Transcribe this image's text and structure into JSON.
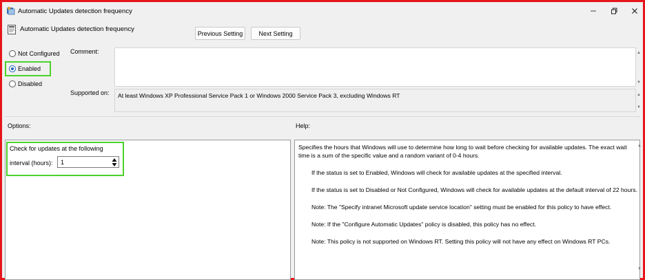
{
  "window": {
    "title": "Automatic Updates detection frequency",
    "controls": [
      "minimize-icon",
      "restore-icon",
      "close-icon"
    ]
  },
  "header": {
    "title": "Automatic Updates detection frequency",
    "previous_label": "Previous Setting",
    "next_label": "Next Setting"
  },
  "state": {
    "options": [
      "Not Configured",
      "Enabled",
      "Disabled"
    ],
    "selected": "Enabled"
  },
  "comment": {
    "label": "Comment:",
    "value": ""
  },
  "supported": {
    "label": "Supported on:",
    "value": "At least Windows XP Professional Service Pack 1 or Windows 2000 Service Pack 3, excluding Windows RT"
  },
  "options_panel": {
    "heading": "Options:",
    "line1": "Check for updates at the following",
    "interval_label": "interval (hours):",
    "interval_value": "1"
  },
  "help_panel": {
    "heading": "Help:",
    "paragraphs": [
      "Specifies the hours that Windows will use to determine how long to wait before checking for available updates. The exact wait time is a sum of the specific value and a random variant of 0-4 hours.",
      "If the status is set to Enabled, Windows will check for available updates at the specified interval.",
      "If the status is set to Disabled or Not Configured, Windows will check for available updates at the default interval of 22 hours.",
      "Note: The \"Specify intranet Microsoft update service location\" setting must be enabled for this policy to have effect.",
      "Note: If the \"Configure Automatic Updates\" policy is disabled, this policy has no effect.",
      "Note: This policy is not supported on Windows RT. Setting this policy will not have any effect on Windows RT PCs."
    ]
  },
  "colors": {
    "highlight": "#4cd12c",
    "frame": "#e8141b",
    "accent": "#1f5fb5"
  }
}
